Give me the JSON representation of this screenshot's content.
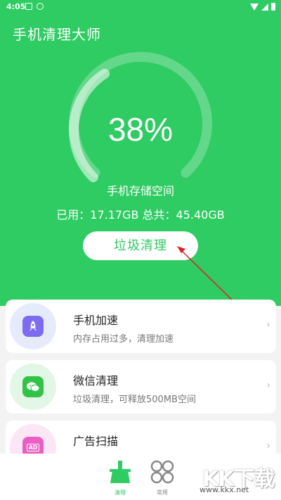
{
  "status_bar": {
    "time": "4:05"
  },
  "app": {
    "title": "手机清理大师"
  },
  "storage": {
    "percent_text": "38%",
    "percent_value": 38,
    "label": "手机存储空间",
    "used_total": "已用：17.17GB   总共：45.40GB"
  },
  "clean_button": {
    "label": "垃圾清理"
  },
  "cards": [
    {
      "title": "手机加速",
      "desc": "内存占用过多，清理加速",
      "icon": "rocket-icon",
      "icon_color": "#7d6bf0",
      "bg": "#e6ebfb"
    },
    {
      "title": "微信清理",
      "desc": "垃圾清理，可释放500MB空间",
      "icon": "wechat-icon",
      "icon_color": "#30c346",
      "bg": "#e3f7e6"
    },
    {
      "title": "广告扫描",
      "desc": "",
      "icon": "ad-icon",
      "icon_color": "#e95fc4",
      "bg": "#fbe6f5",
      "icon_text": "AD"
    }
  ],
  "bottom_nav": [
    {
      "label": "清理",
      "active": true
    },
    {
      "label": "常用",
      "active": false
    }
  ],
  "watermark": {
    "text": "KK下载",
    "url": "www.kkx.net"
  },
  "colors": {
    "brand_green": "#2fcb63",
    "arrow_red": "#e02020"
  }
}
